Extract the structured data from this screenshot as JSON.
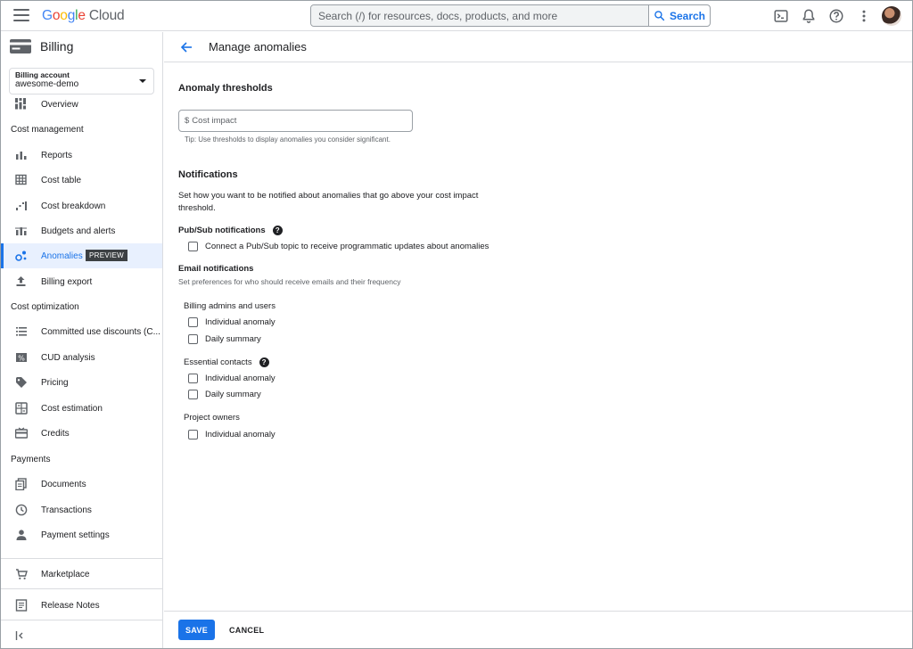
{
  "app": {
    "logo_google": "Google",
    "logo_cloud": "Cloud"
  },
  "search": {
    "placeholder": "Search (/) for resources, docs, products, and more",
    "button_label": "Search"
  },
  "sidebar": {
    "title": "Billing",
    "account_label": "Billing account",
    "account_value": "awesome-demo",
    "sections": {
      "cost_management": "Cost management",
      "cost_optimization": "Cost optimization",
      "payments": "Payments"
    },
    "items": {
      "overview": "Overview",
      "reports": "Reports",
      "cost_table": "Cost table",
      "cost_breakdown": "Cost breakdown",
      "budgets": "Budgets and alerts",
      "anomalies": "Anomalies",
      "anomalies_badge": "PREVIEW",
      "billing_export": "Billing export",
      "committed": "Committed use discounts (C...",
      "cud": "CUD analysis",
      "pricing": "Pricing",
      "cost_estimation": "Cost estimation",
      "credits": "Credits",
      "documents": "Documents",
      "transactions": "Transactions",
      "payment_settings": "Payment settings",
      "marketplace": "Marketplace",
      "release_notes": "Release Notes"
    }
  },
  "main": {
    "title": "Manage anomalies",
    "thresholds_heading": "Anomaly thresholds",
    "cost_prefix": "$",
    "cost_placeholder": "Cost impact",
    "tip": "Tip: Use thresholds to display anomalies you consider significant.",
    "notifications_heading": "Notifications",
    "notifications_desc": "Set how you want to be notified about anomalies that go above your cost impact threshold.",
    "pubsub_label": "Pub/Sub notifications",
    "pubsub_option": "Connect a Pub/Sub topic to receive programmatic updates about anomalies",
    "email_label": "Email notifications",
    "email_desc": "Set preferences for who should receive emails and their frequency",
    "groups": {
      "billing_admins": "Billing admins and users",
      "essential_contacts": "Essential contacts",
      "project_owners": "Project owners"
    },
    "options": {
      "individual": "Individual anomaly",
      "daily": "Daily summary"
    }
  },
  "footer": {
    "save": "SAVE",
    "cancel": "CANCEL"
  },
  "colors": {
    "accent": "#1a73e8",
    "text": "#202124",
    "muted": "#5f6368",
    "border": "#dadce0"
  }
}
